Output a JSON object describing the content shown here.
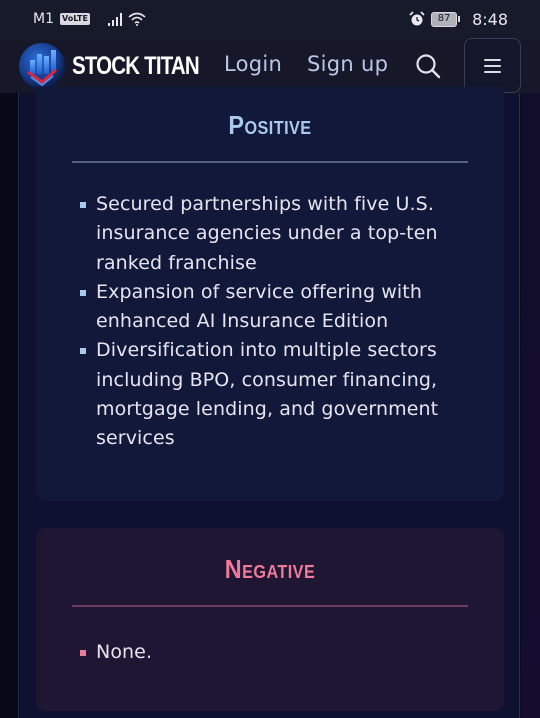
{
  "status_bar": {
    "carrier": "M1",
    "volte_badge": "VoLTE",
    "battery_level": "87",
    "time": "8:48",
    "icons": [
      "signal-icon",
      "wifi-icon",
      "alarm-icon",
      "battery-icon"
    ]
  },
  "navbar": {
    "brand": "STOCK TITAN",
    "login_label": "Login",
    "signup_label": "Sign up",
    "icons": [
      "logo-icon",
      "search-icon",
      "hamburger-menu-icon"
    ]
  },
  "positive": {
    "title": "Positive",
    "accent_color": "#a9c9ee",
    "items": [
      "Secured partnerships with five U.S. insurance agencies under a top-ten ranked franchise",
      "Expansion of service offering with enhanced AI Insurance Edition",
      "Diversification into multiple sectors including BPO, consumer financing, mortgage lending, and government services"
    ]
  },
  "negative": {
    "title": "Negative",
    "accent_color": "#ef7a9a",
    "items": [
      "None."
    ]
  }
}
